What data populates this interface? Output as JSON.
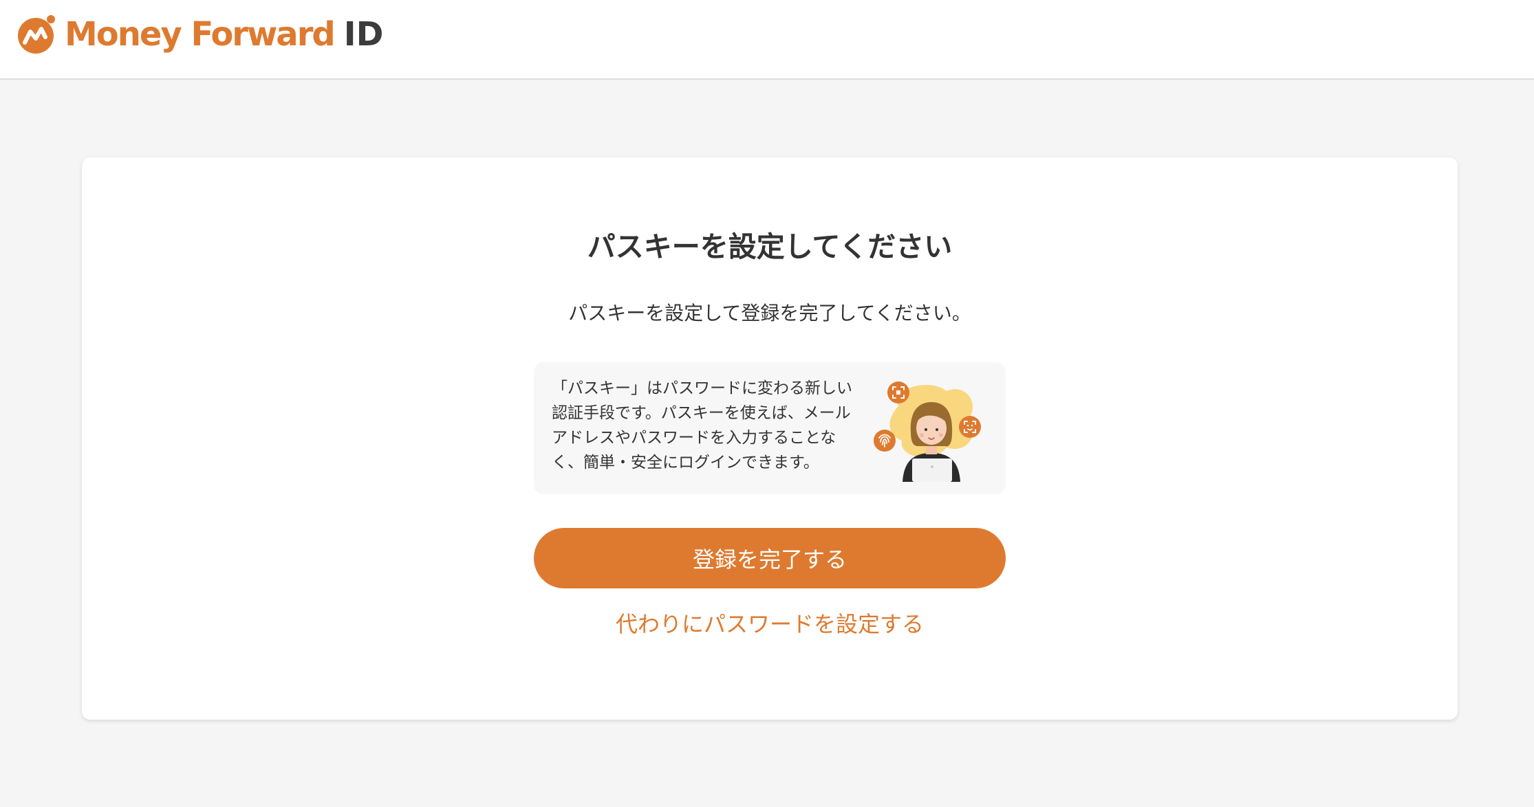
{
  "header": {
    "logo_wordmark": "Money Forward",
    "logo_suffix": "ID"
  },
  "main": {
    "title": "パスキーを設定してください",
    "lead": "パスキーを設定して登録を完了してください。",
    "info_text": "「パスキー」はパスワードに変わる新しい認証手段です。パスキーを使えば、メールアドレスやパスワードを入力することなく、簡単・安全にログインできます。",
    "primary_button_label": "登録を完了する",
    "alt_link_label": "代わりにパスワードを設定する"
  },
  "colors": {
    "brand_orange": "#de7a2f",
    "background": "#f5f5f5",
    "card": "#ffffff",
    "info_box": "#f7f7f7",
    "text": "#333333"
  },
  "icons": [
    "money-forward-logo-icon",
    "passkey-illustration",
    "qr-scan-icon",
    "face-id-icon",
    "fingerprint-icon"
  ]
}
